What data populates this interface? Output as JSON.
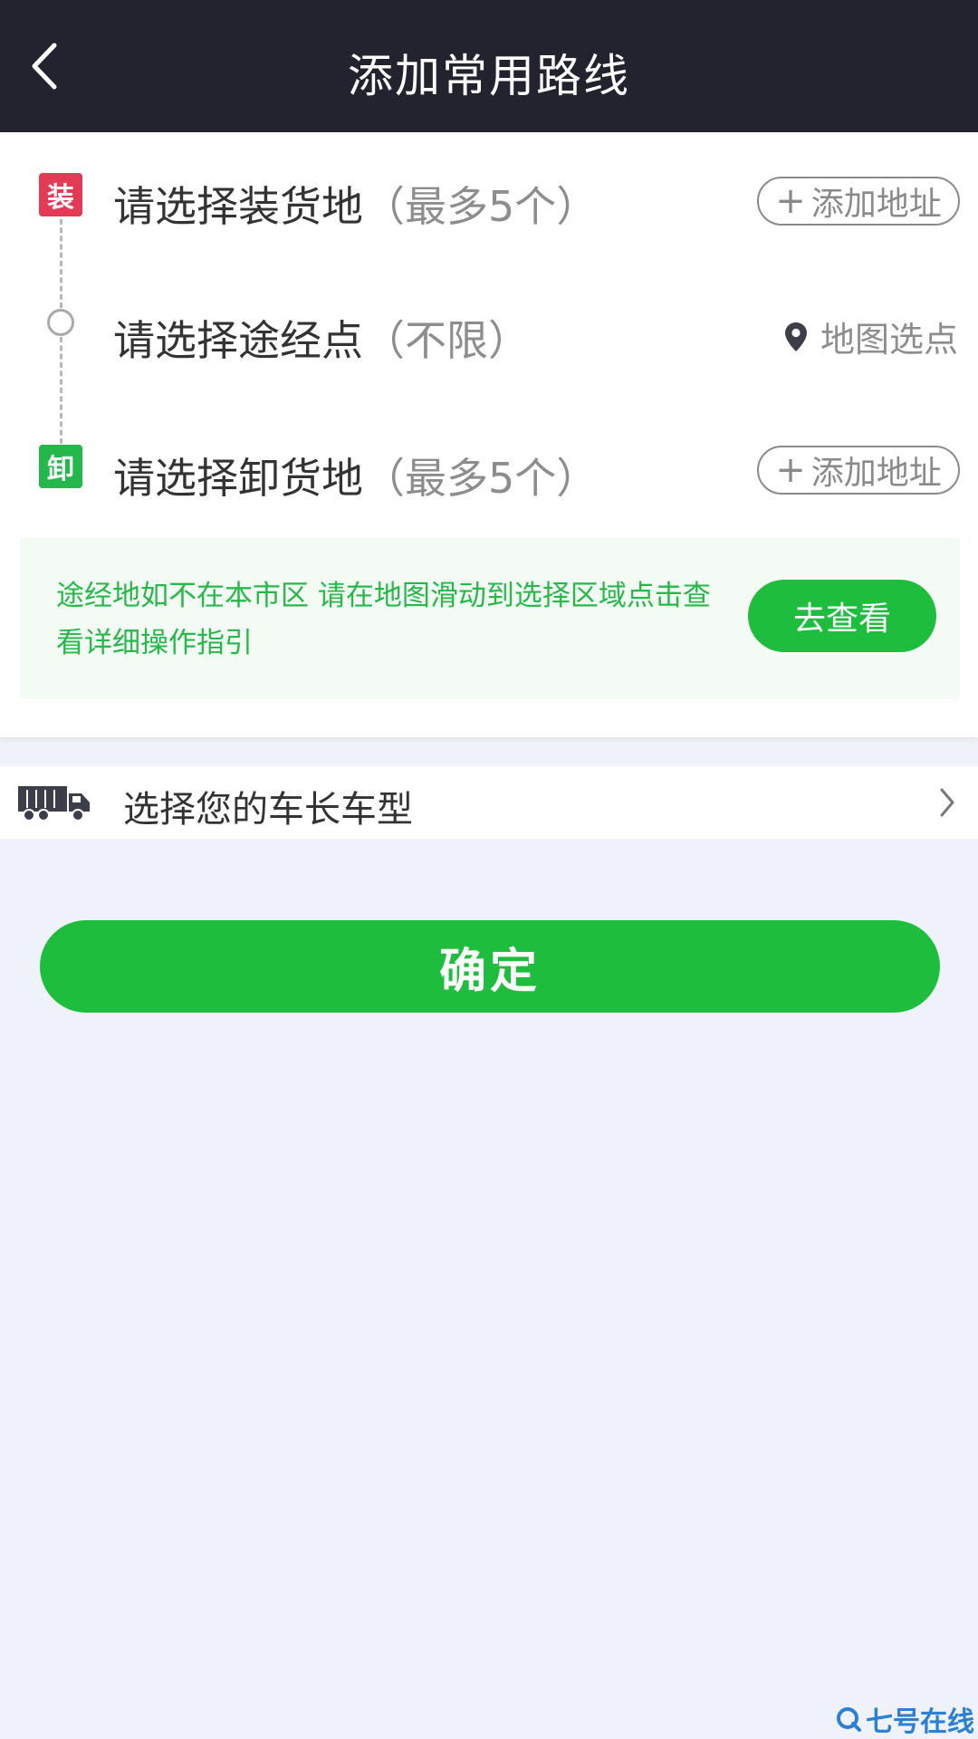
{
  "header": {
    "title": "添加常用路线",
    "back_icon": "chevron-left-icon"
  },
  "route": {
    "load": {
      "badge": "装",
      "label": "请选择装货地",
      "hint": "（最多5个）",
      "action": "添加地址",
      "badge_color": "#e33a55"
    },
    "via": {
      "label": "请选择途经点",
      "hint": "（不限）",
      "action": "地图选点",
      "icon": "map-pin-icon"
    },
    "unload": {
      "badge": "卸",
      "label": "请选择卸货地",
      "hint": "（最多5个）",
      "action": "添加地址",
      "badge_color": "#24b84a"
    }
  },
  "notice": {
    "text": "途经地如不在本市区 请在地图滑动到选择区域点击查看详细操作指引",
    "button": "去查看"
  },
  "vehicle": {
    "label": "选择您的车长车型",
    "icon": "truck-icon"
  },
  "confirm": {
    "label": "确定"
  },
  "watermark": {
    "text": "七号在线"
  },
  "colors": {
    "accent_green": "#1fbd3d",
    "topbar": "#22232f",
    "background": "#eff2f8"
  }
}
